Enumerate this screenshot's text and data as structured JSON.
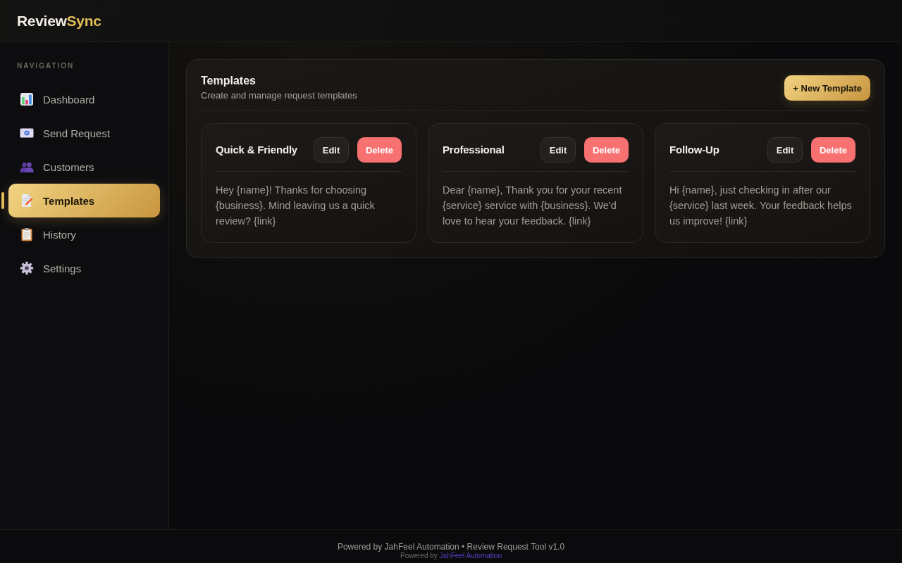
{
  "logo": {
    "parts": [
      {
        "text": "Review",
        "accent": false
      },
      {
        "text": "Sync",
        "accent": true
      }
    ]
  },
  "sidebar": {
    "heading": "NAVIGATION",
    "items": [
      {
        "label": "Dashboard",
        "selected": false
      },
      {
        "label": "Send Request",
        "selected": false
      },
      {
        "label": "Customers",
        "selected": false
      },
      {
        "label": "Templates",
        "selected": true
      },
      {
        "label": "History",
        "selected": false
      },
      {
        "label": "Settings",
        "selected": false
      }
    ]
  },
  "panel": {
    "title": "Templates",
    "subtitle": "Create and manage request templates",
    "action": "+ New Template"
  },
  "templates": [
    {
      "title": "Quick & Friendly",
      "body": "Hey {name}! Thanks for choosing {business}. Mind leaving us a quick review? {link}",
      "actions": [
        {
          "label": "Edit",
          "kind": "secondary"
        },
        {
          "label": "Delete",
          "kind": "danger"
        }
      ]
    },
    {
      "title": "Professional",
      "body": "Dear {name}, Thank you for your recent {service} service with {business}. We'd love to hear your feedback. {link}",
      "actions": [
        {
          "label": "Edit",
          "kind": "secondary"
        },
        {
          "label": "Delete",
          "kind": "danger"
        }
      ]
    },
    {
      "title": "Follow-Up",
      "body": "Hi {name}, just checking in after our {service} last week. Your feedback helps us improve! {link}",
      "actions": [
        {
          "label": "Edit",
          "kind": "secondary"
        },
        {
          "label": "Delete",
          "kind": "danger"
        }
      ]
    }
  ],
  "footer": {
    "text": "Powered by JahFeel Automation • Review Request Tool v1.0",
    "credit": {
      "prefix": "Powered by",
      "link": "JahFeel Automation"
    }
  }
}
